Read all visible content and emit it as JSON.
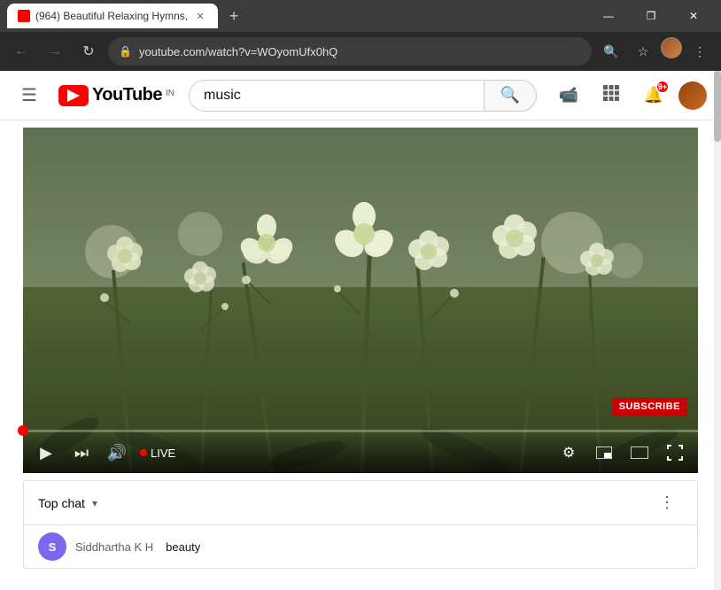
{
  "browser": {
    "tab": {
      "title": "(964) Beautiful Relaxing Hymns,",
      "favicon_color": "#ff0000"
    },
    "new_tab_label": "+",
    "window_controls": {
      "minimize": "—",
      "maximize": "❐",
      "close": "✕"
    },
    "url": "youtube.com/watch?v=WOyomUfx0hQ",
    "nav": {
      "back": "←",
      "forward": "→",
      "refresh": "↻"
    }
  },
  "header": {
    "menu_icon": "☰",
    "logo_text": "YouTube",
    "logo_country": "IN",
    "search_placeholder": "music",
    "search_icon": "🔍",
    "upload_icon": "📹",
    "apps_icon": "⊞",
    "notification_icon": "🔔",
    "notification_count": "9+",
    "user_avatar_label": "User"
  },
  "video": {
    "subscribe_label": "SUBSCRIBE",
    "live_label": "LIVE",
    "controls": {
      "play": "▶",
      "skip": "⏭",
      "volume": "🔊",
      "settings": "⚙",
      "miniplayer": "⧉",
      "theater": "▬",
      "fullscreen": "⛶"
    },
    "progress_percent": 0
  },
  "chat": {
    "header_label": "Top chat",
    "dropdown_arrow": "▾",
    "menu_icon": "⋮",
    "message": {
      "user": "Siddhartha K H",
      "text": "beauty",
      "avatar_letter": "S"
    }
  }
}
